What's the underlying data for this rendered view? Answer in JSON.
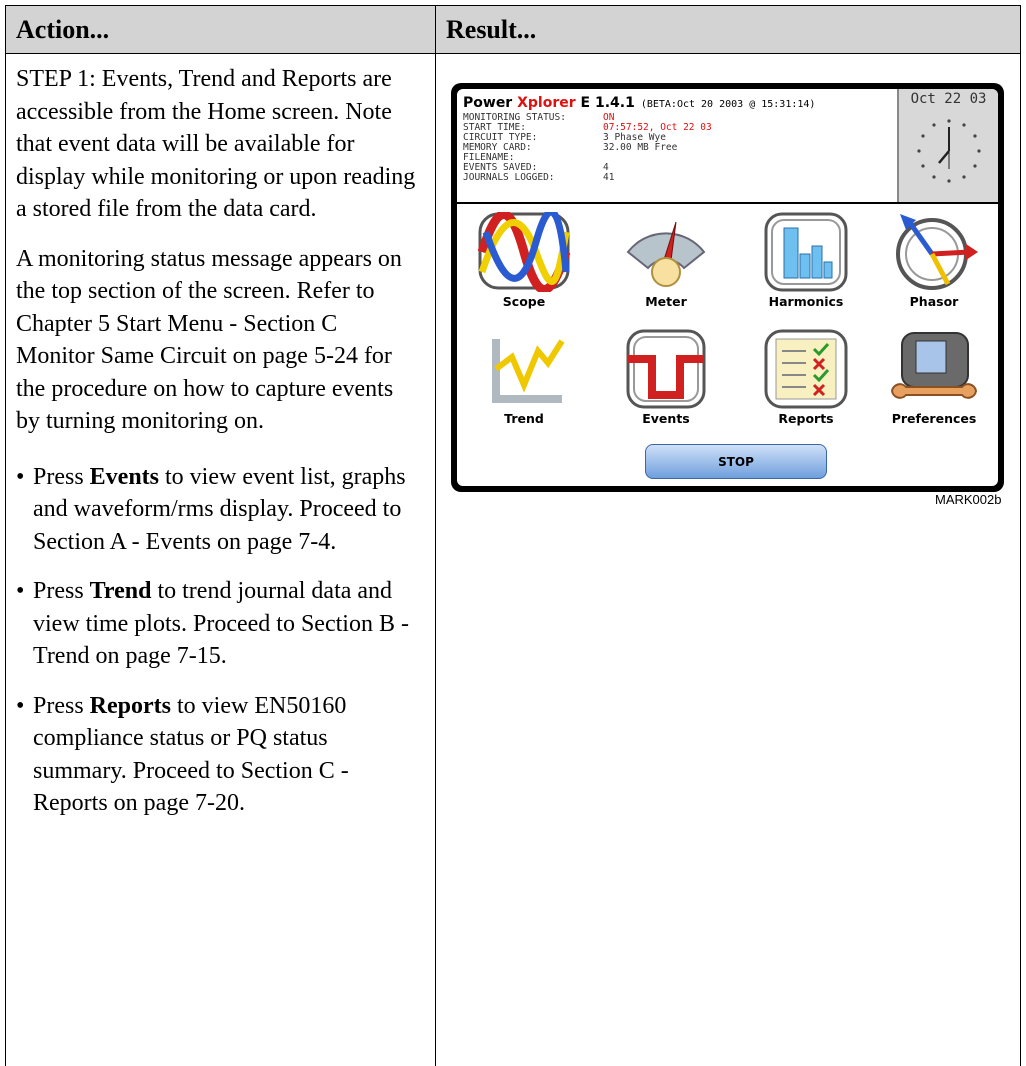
{
  "header": {
    "action": "Action...",
    "result": "Result..."
  },
  "action": {
    "p1": "STEP 1: Events, Trend and Reports are accessible from the Home screen. Note that event data will be available for display while monitoring or upon reading a stored file from the data card.",
    "p2": "A monitoring status message appears on the top section of the screen. Refer to Chapter 5 Start Menu - Section C Monitor Same Circuit on page 5-24 for the procedure on how to capture events by turning monitoring on.",
    "bullets": [
      {
        "pre": "Press ",
        "bold": "Events",
        "post": " to view event list, graphs and waveform/rms display. Proceed to Section A - Events on page 7-4."
      },
      {
        "pre": "Press ",
        "bold": "Trend",
        "post": " to trend journal data and view time plots. Proceed to Section B - Trend on page 7-15."
      },
      {
        "pre": "Press ",
        "bold": "Reports",
        "post": " to view EN50160 compliance status or PQ status summary. Proceed to Section C - Reports on page 7-20."
      }
    ]
  },
  "device": {
    "title_a": "Power ",
    "title_b": "Xplorer",
    "title_c": " E 1.4.1",
    "beta": " (BETA:Oct 20 2003 @ 15:31:14)",
    "date": "Oct 22 03",
    "status": [
      {
        "label": "MONITORING STATUS:",
        "value": "ON"
      },
      {
        "label": "START TIME:",
        "value": "07:57:52, Oct 22 03"
      },
      {
        "label": "CIRCUIT TYPE:",
        "value": "3 Phase Wye"
      },
      {
        "label": "MEMORY CARD:",
        "value": "32.00 MB Free"
      },
      {
        "label": "FILENAME:",
        "value": ""
      },
      {
        "label": "EVENTS SAVED:",
        "value": "4"
      },
      {
        "label": "JOURNALS LOGGED:",
        "value": "41"
      }
    ],
    "tiles": [
      "Scope",
      "Meter",
      "Harmonics",
      "Phasor",
      "Trend",
      "Events",
      "Reports",
      "Preferences"
    ],
    "stop": "STOP"
  },
  "caption": "MARK002b",
  "colors": {
    "header_bg": "#d3d3d3",
    "accent_red": "#e01010",
    "button_blue": "#6f9fdd"
  }
}
